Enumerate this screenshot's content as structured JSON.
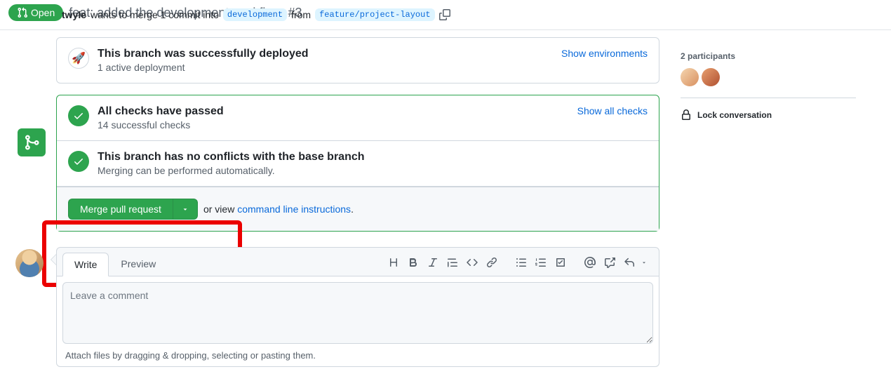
{
  "header": {
    "status": "Open",
    "title": "feat: added the development workflow.",
    "pr_number": "#3",
    "author": "twyle",
    "merge_text_prefix": "wants to merge 1 commit into",
    "base_branch": "development",
    "from_label": "from",
    "head_branch": "feature/project-layout"
  },
  "deploy_box": {
    "title": "This branch was successfully deployed",
    "subtitle": "1 active deployment",
    "link": "Show environments"
  },
  "checks_box": {
    "title": "All checks have passed",
    "subtitle": "14 successful checks",
    "link": "Show all checks"
  },
  "conflicts_box": {
    "title": "This branch has no conflicts with the base branch",
    "subtitle": "Merging can be performed automatically."
  },
  "merge_action": {
    "button": "Merge pull request",
    "or_view": "or view",
    "cli_link": "command line instructions",
    "period": "."
  },
  "comment": {
    "tab_write": "Write",
    "tab_preview": "Preview",
    "placeholder": "Leave a comment",
    "attach_hint": "Attach files by dragging & dropping, selecting or pasting them."
  },
  "sidebar": {
    "participants_label": "2 participants",
    "lock_label": "Lock conversation"
  }
}
